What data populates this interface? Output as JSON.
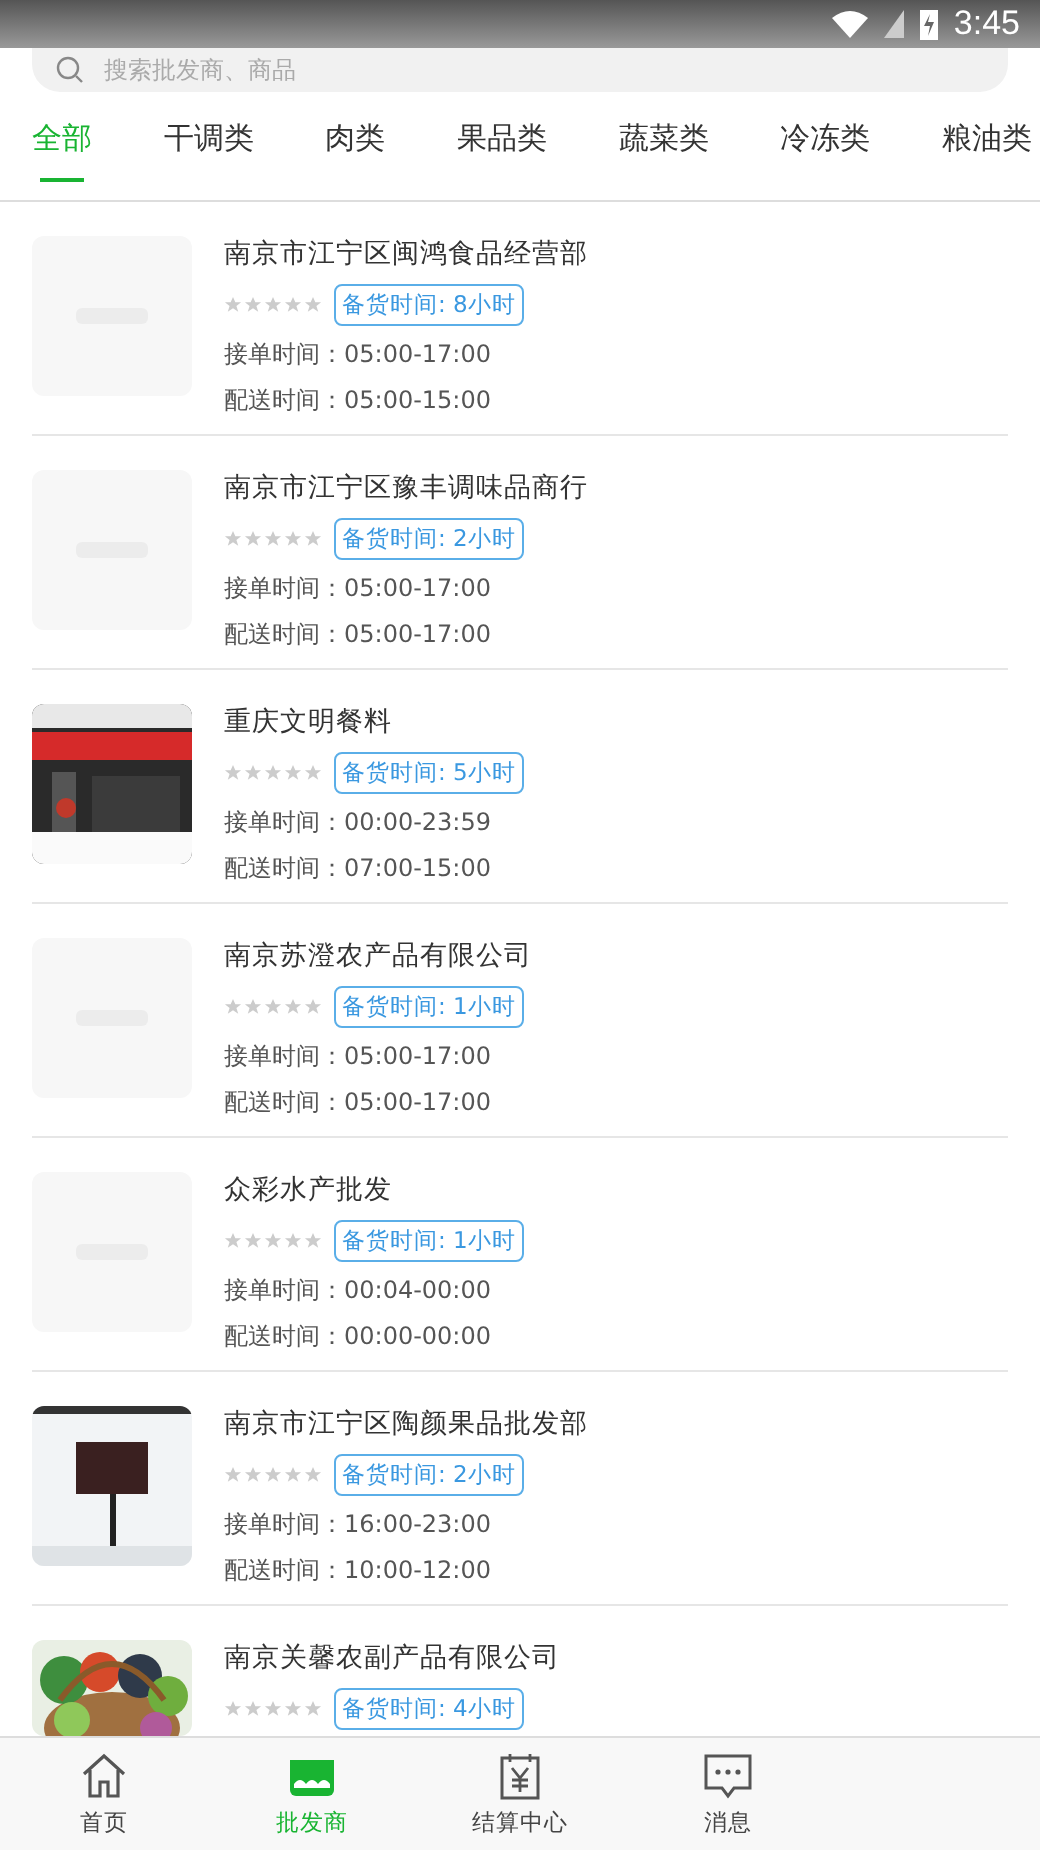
{
  "status_bar": {
    "time": "3:45"
  },
  "search": {
    "placeholder": "搜索批发商、商品"
  },
  "categories": [
    {
      "label": "全部",
      "selected": true
    },
    {
      "label": "干调类",
      "selected": false
    },
    {
      "label": "肉类",
      "selected": false
    },
    {
      "label": "果品类",
      "selected": false
    },
    {
      "label": "蔬菜类",
      "selected": false
    },
    {
      "label": "冷冻类",
      "selected": false
    },
    {
      "label": "粮油类",
      "selected": false
    }
  ],
  "shops": [
    {
      "name": "南京市江宁区闽鸿食品经营部",
      "kind": "placeholder",
      "stars": 0,
      "prep": "备货时间: 8小时",
      "order_time": "接单时间：05:00-17:00",
      "delivery_time": "配送时间：05:00-15:00"
    },
    {
      "name": "南京市江宁区豫丰调味品商行",
      "kind": "placeholder",
      "stars": 0,
      "prep": "备货时间: 2小时",
      "order_time": "接单时间：05:00-17:00",
      "delivery_time": "配送时间：05:00-17:00"
    },
    {
      "name": "重庆文明餐料",
      "kind": "picture",
      "stars": 0,
      "prep": "备货时间: 5小时",
      "order_time": "接单时间：00:00-23:59",
      "delivery_time": "配送时间：07:00-15:00"
    },
    {
      "name": "南京苏澄农产品有限公司",
      "kind": "placeholder",
      "stars": 0,
      "prep": "备货时间: 1小时",
      "order_time": "接单时间：05:00-17:00",
      "delivery_time": "配送时间：05:00-17:00"
    },
    {
      "name": "众彩水产批发",
      "kind": "placeholder",
      "stars": 0,
      "prep": "备货时间: 1小时",
      "order_time": "接单时间：00:04-00:00",
      "delivery_time": "配送时间：00:00-00:00"
    },
    {
      "name": "南京市江宁区陶颜果品批发部",
      "kind": "picture",
      "stars": 0,
      "prep": "备货时间: 2小时",
      "order_time": "接单时间：16:00-23:00",
      "delivery_time": "配送时间：10:00-12:00"
    },
    {
      "name": "南京关馨农副产品有限公司",
      "kind": "picture",
      "stars": 0,
      "prep": "备货时间: 4小时"
    }
  ],
  "nav": [
    {
      "label": "首页",
      "selected": false
    },
    {
      "label": "批发商",
      "selected": true
    },
    {
      "label": "结算中心",
      "selected": false
    },
    {
      "label": "消息",
      "selected": false
    }
  ]
}
